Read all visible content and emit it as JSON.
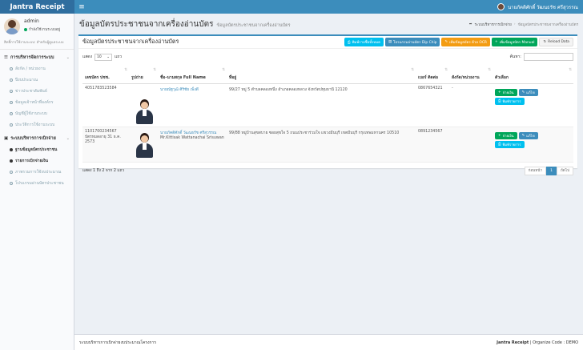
{
  "app": {
    "name": "Jantra Receipt"
  },
  "topbar": {
    "menu_icon": "bars-icon",
    "user_name": "นายภัคติศักดิ์ วัฒนธรัช ศรีสุวรรณ"
  },
  "sidebar": {
    "user": {
      "name": "admin",
      "status": "กำลังใช้งานระบบอยู่",
      "note": "สิทธิ์การใช้งานระบบ: สำหรับผู้ดูแลระบบ"
    },
    "sections": [
      {
        "title": "การบริหารจัดการระบบ",
        "items": [
          {
            "label": "สังกัด / หน่วยงาน",
            "active": false
          },
          {
            "label": "ปีงบประมาณ",
            "active": false
          },
          {
            "label": "ข่าวประชาสัมพันธ์",
            "active": false
          },
          {
            "label": "ข้อมูลเจ้าหน้าที่องค์กร",
            "active": false
          },
          {
            "label": "บัญชีผู้ใช้งานระบบ",
            "active": false
          },
          {
            "label": "ประวัติการใช้งานระบบ",
            "active": false
          }
        ]
      },
      {
        "title": "ระบบบริหารการเบิกจ่าย",
        "items": [
          {
            "label": "ฐานข้อมูลบัตรประชาชน",
            "active": true
          },
          {
            "label": "รายการเบิกจ่ายเงิน",
            "active": true
          },
          {
            "label": "ภาพรวมการใช้งบประมาณ",
            "active": false
          },
          {
            "label": "โปรแกรมอ่านบัตรประชาชน",
            "active": false
          }
        ]
      }
    ]
  },
  "header": {
    "title": "ข้อมูลบัตรประชาชนจากเครื่องอ่านบัตร",
    "subtitle": "ข้อมูลบัตรประชาชนจากเครื่องอ่านบัตร",
    "breadcrumb": [
      "ระบบบริหารการเบิกจ่าย",
      "ข้อมูลบัตรประชาชนจากเครื่องอ่านบัตร"
    ]
  },
  "box": {
    "title": "ข้อมูลบัตรประชาชนจากเครื่องอ่านบัตร",
    "tools": {
      "print": "พิมพ์รายชื่อทั้งหมด",
      "program": "โปรแกรมอ่านบัตร Dip Chip",
      "add_ocr": "เพิ่มข้อมูลบัตร ด้วย OCR",
      "add_manual": "เพิ่มข้อมูลบัตร Manual",
      "reload": "Reload Data"
    }
  },
  "datatable": {
    "show_label": "แสดง",
    "length": "10",
    "rows_label": "แถว",
    "search_label": "ค้นหา:",
    "search_value": "",
    "columns": [
      "เลขบัตร ปชช.",
      "รูปถ่าย",
      "ชื่อ-นามสกุล Full Name",
      "ที่อยู่",
      "เบอร์ ติดต่อ",
      "สังกัด/หน่วยงาน",
      "ตัวเลือก"
    ],
    "rows": [
      {
        "id_no": "4051783523584",
        "expiry": "",
        "name_th": "นายณัฐวุฒิ ศิริชัย เพ็งดี",
        "name_en": "",
        "address": "99/27 หมู่ 5 ตำบลคลองหนึ่ง อำเภอคลองหลวง จังหวัดปทุมธานี 12120",
        "phone": "0867654321",
        "unit": "-"
      },
      {
        "id_no": "1101700234567",
        "expiry": "บัตรหมดอายุ 31 ธ.ค. 2573",
        "name_th": "นายภัคติศักดิ์ วัฒนธรัช ศรีสุวรรณ",
        "name_en": "Mr.Kittisak Wattanachai Srisuwan",
        "address": "99/88 หมู่บ้านสุขสบาย ซอยสุขใจ 5 ถนนประชาร่วมใจ แขวงมีนบุรี เขตมีนบุรี กรุงเทพมหานคร 10510",
        "phone": "0891234567",
        "unit": ""
      }
    ],
    "actions": {
      "pay": "จ่ายเงิน",
      "edit": "แก้ไข",
      "print": "พิมพ์รายการ"
    },
    "info": "แสดง 1 ถึง 2 จาก 2 แถว",
    "pagination": {
      "prev": "ก่อนหน้า",
      "current": "1",
      "next": "ถัดไป"
    }
  },
  "footer": {
    "left": "ระบบบริหารการเบิกจ่ายงบประมาณโครงการ",
    "brand": "Jantra Receipt",
    "org": "| Organize Code : DEMO"
  },
  "colors": {
    "primary": "#3c8dbc",
    "info": "#00c0ef",
    "success": "#00a65a",
    "warning": "#f39c12"
  }
}
